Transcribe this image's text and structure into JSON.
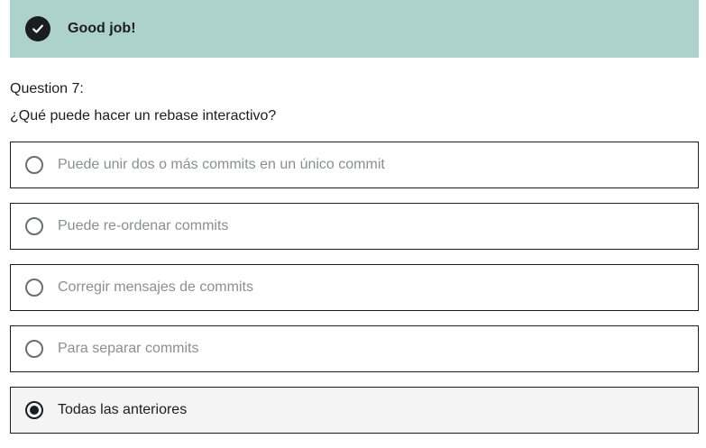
{
  "banner": {
    "text": "Good job!",
    "icon": "check-icon",
    "color": "#acd2cb"
  },
  "question": {
    "label": "Question 7:",
    "text": "¿Qué puede hacer un rebase interactivo?"
  },
  "answers": [
    {
      "label": "Puede unir dos o más commits en un único commit",
      "selected": false
    },
    {
      "label": "Puede re-ordenar commits",
      "selected": false
    },
    {
      "label": "Corregir mensajes de commits",
      "selected": false
    },
    {
      "label": "Para separar commits",
      "selected": false
    },
    {
      "label": "Todas las anteriores",
      "selected": true
    }
  ]
}
